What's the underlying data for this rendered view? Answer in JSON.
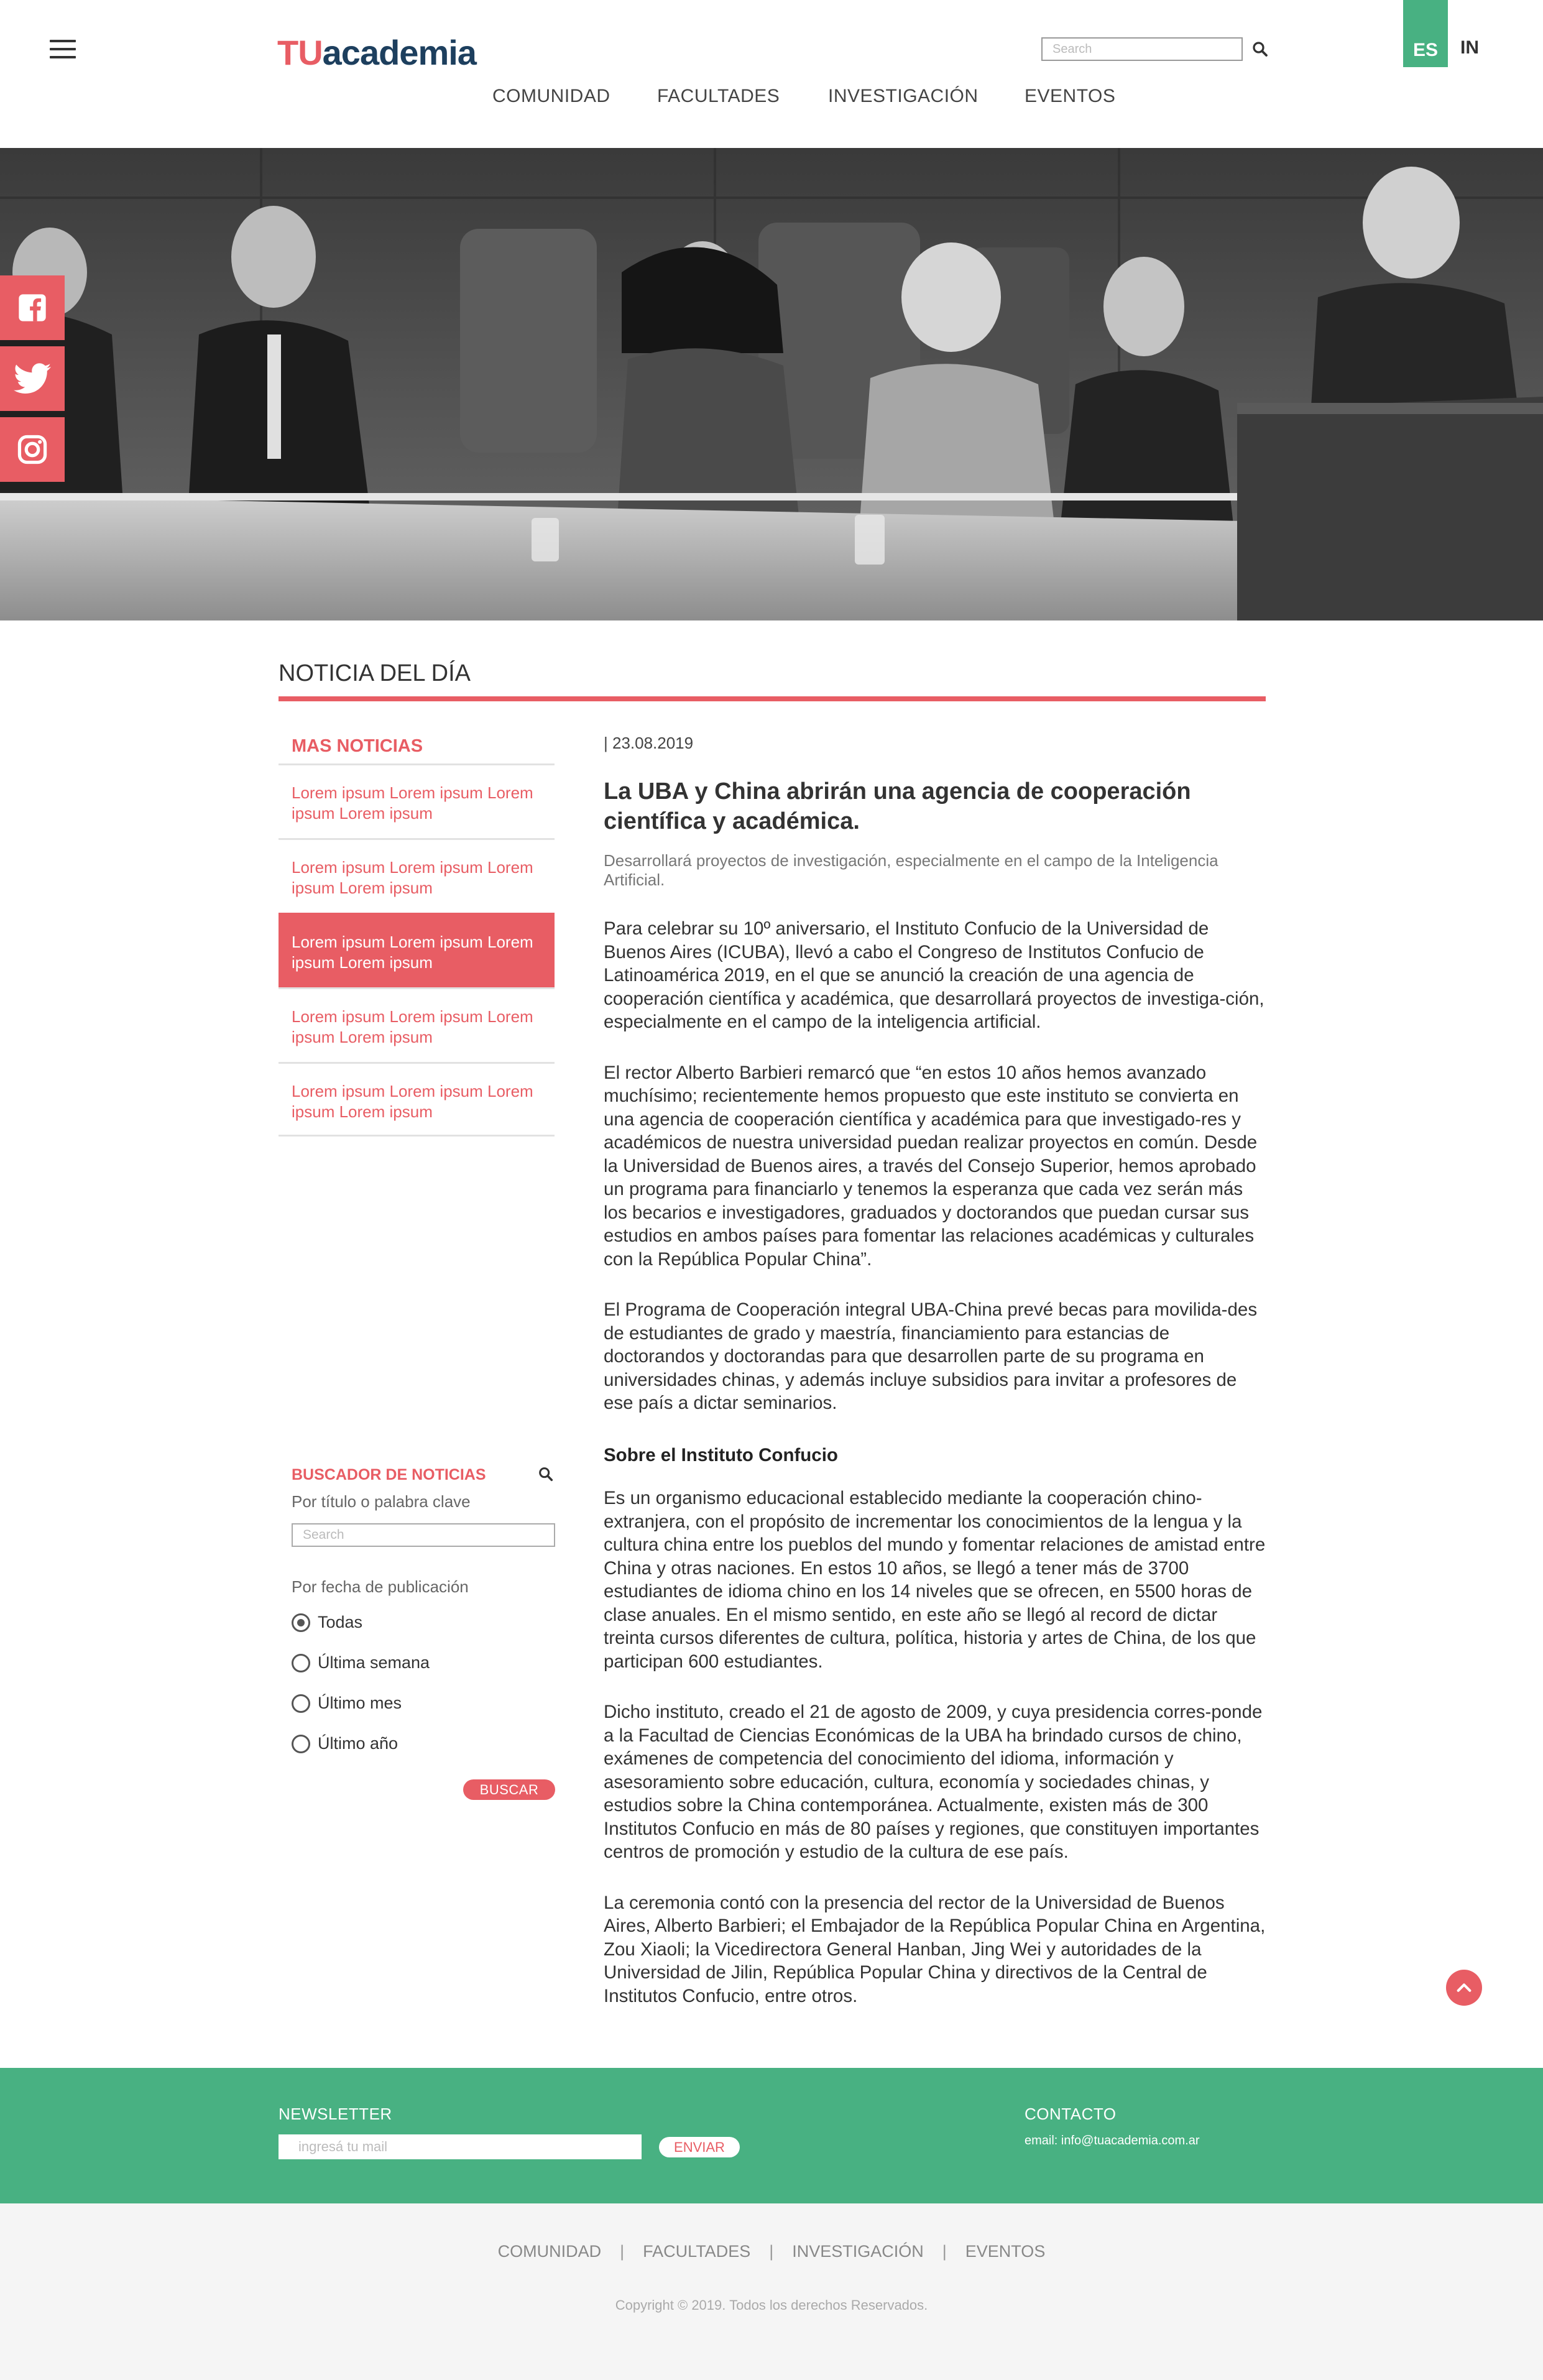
{
  "header": {
    "logo_tu": "TU",
    "logo_academia": "academia",
    "search_placeholder": "Search",
    "lang_es": "ES",
    "lang_in": "IN"
  },
  "nav": [
    "COMUNIDAD",
    "FACULTADES",
    "INVESTIGACIÓN",
    "EVENTOS"
  ],
  "section_title": "NOTICIA DEL DÍA",
  "sidebar": {
    "heading": "MAS NOTICIAS",
    "items": [
      {
        "label": "Lorem ipsum Lorem ipsum Lorem ipsum Lorem ipsum",
        "active": false
      },
      {
        "label": "Lorem ipsum Lorem ipsum Lorem ipsum Lorem ipsum",
        "active": false
      },
      {
        "label": "Lorem ipsum Lorem ipsum Lorem ipsum Lorem ipsum",
        "active": true
      },
      {
        "label": "Lorem ipsum Lorem ipsum Lorem ipsum Lorem ipsum",
        "active": false
      },
      {
        "label": "Lorem ipsum Lorem ipsum Lorem ipsum Lorem ipsum",
        "active": false
      }
    ]
  },
  "finder": {
    "title": "BUSCADOR DE NOTICIAS",
    "subtitle": "Por título o palabra clave",
    "search_placeholder": "Search",
    "date_label": "Por fecha de publicación",
    "options": [
      "Todas",
      "Última semana",
      "Último mes",
      "Último año"
    ],
    "selected": "Todas",
    "button": "BUSCAR"
  },
  "article": {
    "date": "| 23.08.2019",
    "title": "La UBA y China abrirán una agencia de cooperación científica y académica.",
    "lead": "Desarrollará proyectos de investigación, especialmente en el campo de la Inteligencia Artificial.",
    "p1": "Para celebrar su 10º aniversario, el Instituto Confucio de la Universidad de Buenos Aires (ICUBA), llevó a cabo el Congreso de Institutos Confucio de Latinoamérica 2019, en el que se anunció la creación de una agencia de cooperación científica y académica, que desarrollará proyectos de investiga-ción, especialmente en el campo de la inteligencia artificial.",
    "p2": "El rector Alberto Barbieri remarcó que “en estos 10 años hemos avanzado muchísimo; recientemente hemos propuesto que este instituto se convierta en una agencia de cooperación científica y académica para que investigado-res y académicos de nuestra universidad puedan realizar proyectos en común. Desde la Universidad de Buenos aires, a través del Consejo Superior, hemos aprobado un programa para financiarlo  y tenemos la esperanza que cada vez serán más los becarios e investigadores, graduados y doctorandos que puedan cursar sus estudios en ambos países para fomentar las relaciones académicas y culturales con la República Popular China”.",
    "p3": "El Programa de Cooperación integral UBA-China prevé becas para movilida-des de estudiantes de grado y maestría, financiamiento para estancias de doctorandos y doctorandas para que desarrollen parte de su programa en universidades chinas, y además incluye subsidios para invitar a profesores de ese país a dictar seminarios.",
    "subheading": "Sobre el Instituto Confucio",
    "p4": "Es un organismo educacional establecido mediante la cooperación chino-extranjera, con el propósito de incrementar los conocimientos de la lengua y la cultura china entre los pueblos del mundo y fomentar relaciones de amistad entre China y otras naciones. En estos 10 años, se llegó a tener más de 3700 estudiantes de idioma chino en los 14 niveles que se ofrecen, en 5500 horas de clase anuales. En el mismo sentido, en este año se llegó al record de dictar treinta cursos diferentes de cultura, política, historia y artes de China, de los que participan 600 estudiantes.",
    "p5": "Dicho instituto, creado el 21 de agosto de 2009, y cuya presidencia corres-ponde a la Facultad de Ciencias Económicas de la UBA ha brindado cursos de chino, exámenes de competencia del conocimiento del idioma, información y asesoramiento sobre educación, cultura, economía y sociedades chinas, y estudios sobre la China contemporánea. Actualmente, existen más de 300 Institutos Confucio en más de 80 países y regiones, que constituyen importantes centros de promoción y estudio de la cultura de ese país.",
    "p6": "La ceremonia contó con la presencia del rector de la Universidad de Buenos Aires, Alberto Barbieri; el Embajador de la República Popular China en Argentina, Zou Xiaoli; la Vicedirectora General Hanban, Jing Wei y autoridades de la Universidad de Jilin, República Popular China y directivos de la Central de Institutos Confucio, entre otros."
  },
  "footer": {
    "newsletter_title": "NEWSLETTER",
    "newsletter_placeholder": "ingresá tu mail",
    "newsletter_button": "ENVIAR",
    "contact_title": "CONTACTO",
    "contact_email": "email: info@tuacademia.com.ar",
    "nav": [
      "COMUNIDAD",
      "FACULTADES",
      "INVESTIGACIÓN",
      "EVENTOS"
    ],
    "copyright": "Copyright © 2019. Todos los derechos Reservados."
  },
  "colors": {
    "accent": "#e85d64",
    "green": "#48b182",
    "navy": "#1d3f5e"
  },
  "icons": [
    "menu-icon",
    "search-icon",
    "facebook-icon",
    "twitter-icon",
    "instagram-icon",
    "chevron-up-icon"
  ]
}
